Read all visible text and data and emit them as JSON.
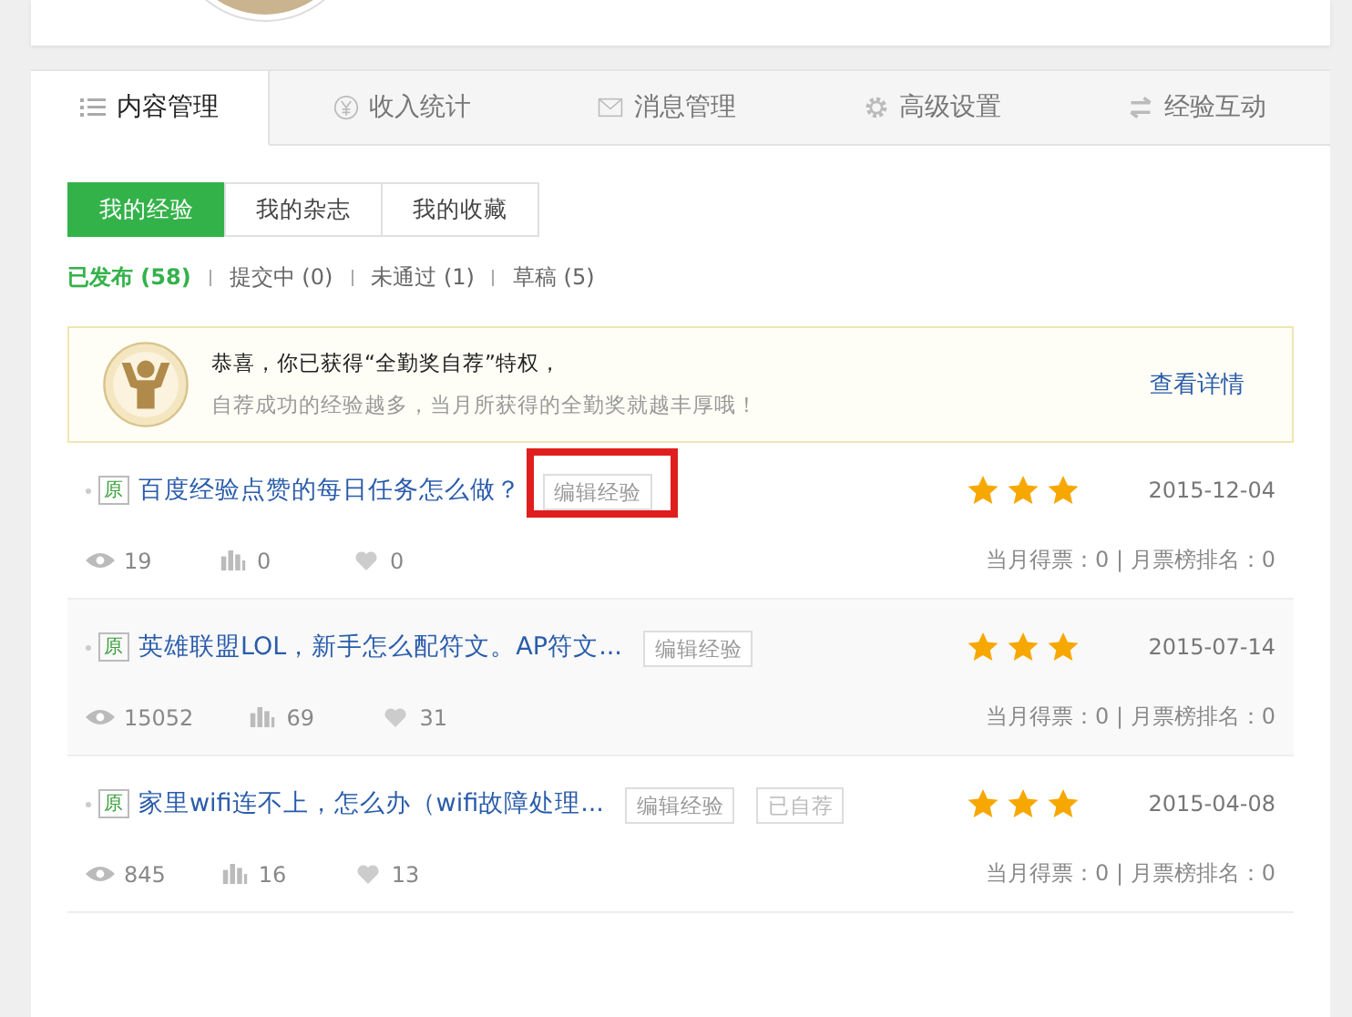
{
  "tabs": [
    {
      "label": "内容管理",
      "selected": true
    },
    {
      "label": "收入统计",
      "selected": false
    },
    {
      "label": "消息管理",
      "selected": false
    },
    {
      "label": "高级设置",
      "selected": false
    },
    {
      "label": "经验互动",
      "selected": false
    }
  ],
  "subtabs": [
    {
      "label": "我的经验",
      "selected": true
    },
    {
      "label": "我的杂志",
      "selected": false
    },
    {
      "label": "我的收藏",
      "selected": false
    }
  ],
  "filters": [
    {
      "label": "已发布",
      "count": "(58)",
      "selected": true
    },
    {
      "label": "提交中",
      "count": "(0)",
      "selected": false
    },
    {
      "label": "未通过",
      "count": "(1)",
      "selected": false
    },
    {
      "label": "草稿",
      "count": "(5)",
      "selected": false
    }
  ],
  "notice": {
    "title": "恭喜，你已获得“全勤奖自荐”特权，",
    "text": "自荐成功的经验越多，当月所获得的全勤奖就越丰厚哦！",
    "link": "查看详情"
  },
  "items": [
    {
      "badge": "原",
      "title": "百度经验点赞的每日任务怎么做？",
      "actions": [
        "编辑经验"
      ],
      "highlighted": true,
      "stars": 3,
      "date": "2015-12-04",
      "views": "19",
      "votes": "0",
      "likes": "0",
      "monthly": "当月得票：0 | 月票榜排名：0"
    },
    {
      "badge": "原",
      "title": "英雄联盟LOL，新手怎么配符文。AP符文...",
      "actions": [
        "编辑经验"
      ],
      "highlighted": false,
      "stars": 3,
      "date": "2015-07-14",
      "views": "15052",
      "votes": "69",
      "likes": "31",
      "monthly": "当月得票：0 | 月票榜排名：0"
    },
    {
      "badge": "原",
      "title": "家里wifi连不上，怎么办（wifi故障处理...",
      "actions": [
        "编辑经验",
        "已自荐"
      ],
      "highlighted": false,
      "stars": 3,
      "date": "2015-04-08",
      "views": "845",
      "votes": "16",
      "likes": "13",
      "monthly": "当月得票：0 | 月票榜排名：0"
    }
  ]
}
